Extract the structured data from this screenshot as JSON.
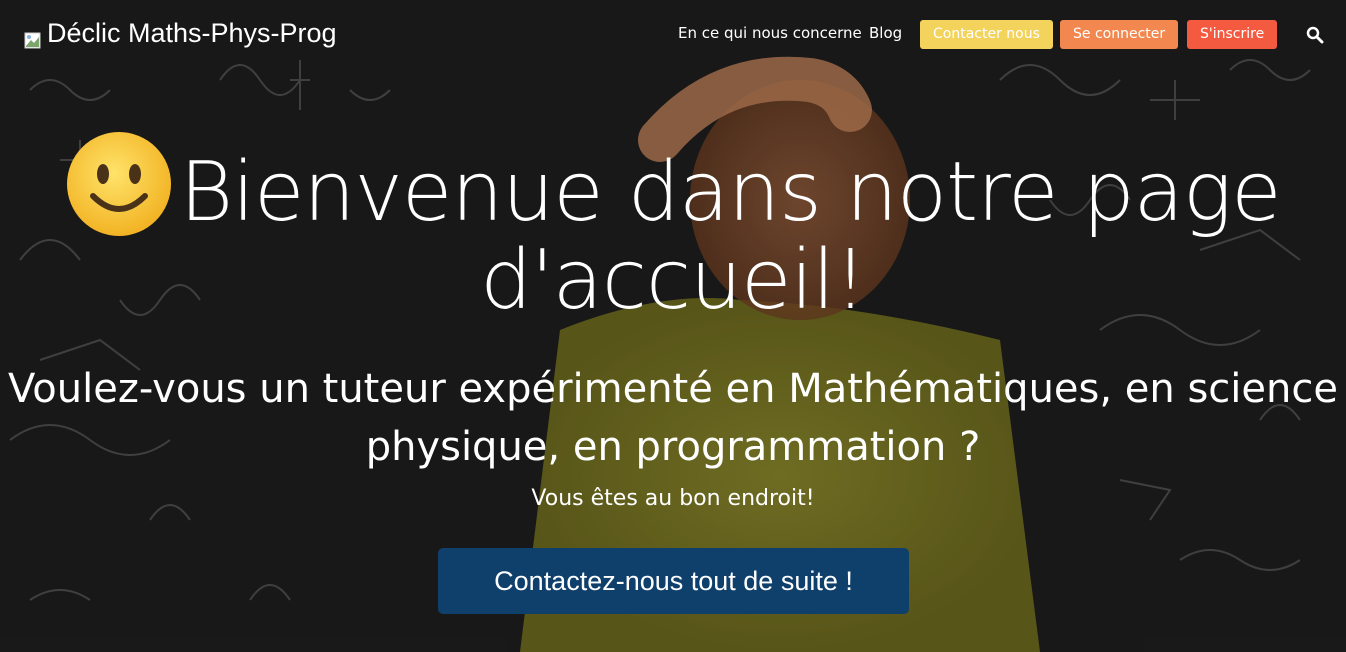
{
  "brand": {
    "name": "Déclic Maths-Phys-Prog",
    "logo_icon": "broken-image-icon"
  },
  "nav": {
    "about": "En ce qui nous concerne",
    "blog": "Blog",
    "contact": "Contacter nous",
    "login": "Se connecter",
    "signup": "S'inscrire",
    "search_icon": "search-icon"
  },
  "hero": {
    "title_line1": "Bienvenue dans notre page",
    "title_line2": "d'accueil!",
    "title_emoji": "slightly-smiling-face",
    "subtitle_line1": "Voulez-vous un tuteur expérimenté en Mathématiques, en science",
    "subtitle_line2": "physique, en programmation ?",
    "tagline": "Vous êtes au bon endroit!",
    "cta": "Contactez-nous tout de suite !"
  },
  "colors": {
    "contact_btn": "#f3d35b",
    "login_btn": "#f2874f",
    "signup_btn": "#f35a3f",
    "cta_btn": "#0f3f6b"
  }
}
